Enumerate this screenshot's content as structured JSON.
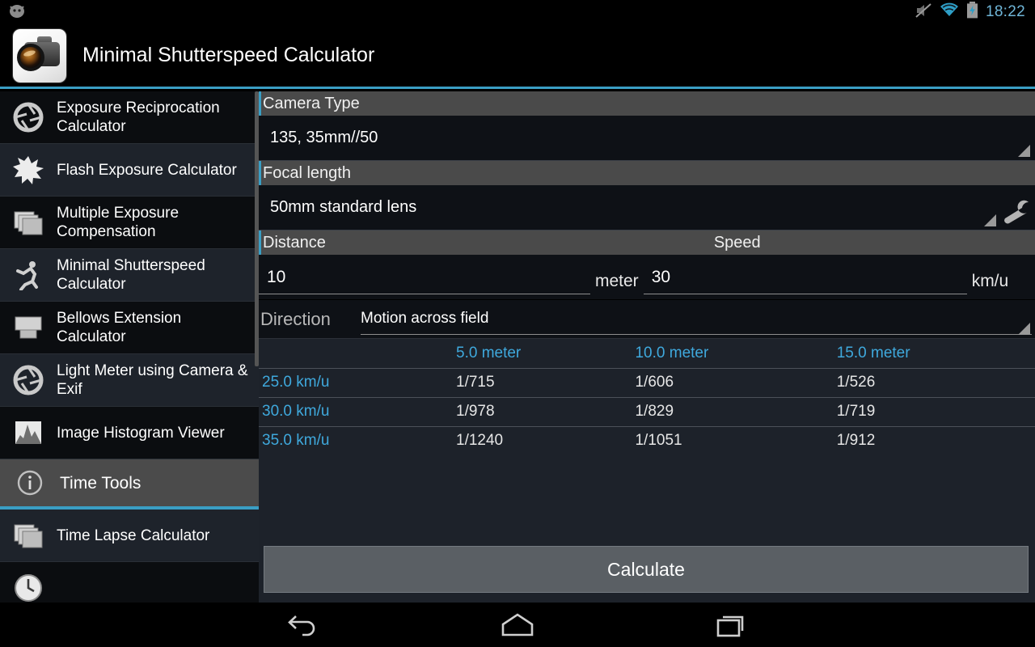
{
  "status_bar": {
    "notification_icon": "android-robot-icon",
    "icons": [
      "mute-icon",
      "wifi-icon",
      "battery-charging-icon"
    ],
    "time": "18:22",
    "time_color": "#6fb6d8"
  },
  "action_bar": {
    "app_icon": "camera-app-icon",
    "title": "Minimal Shutterspeed Calculator",
    "accent_color": "#3a9ec4"
  },
  "sidebar": {
    "items": [
      {
        "label": "Exposure Reciprocation Calculator",
        "icon": "aperture-icon"
      },
      {
        "label": "Flash Exposure Calculator",
        "icon": "flash-burst-icon"
      },
      {
        "label": "Multiple Exposure Compensation",
        "icon": "stacked-layers-icon"
      },
      {
        "label": "Minimal Shutterspeed Calculator",
        "icon": "running-person-icon"
      },
      {
        "label": "Bellows Extension Calculator",
        "icon": "bellows-icon"
      },
      {
        "label": "Light Meter using Camera & Exif",
        "icon": "aperture-icon"
      },
      {
        "label": "Image Histogram Viewer",
        "icon": "histogram-icon"
      }
    ],
    "section": {
      "label": "Time Tools",
      "icon": "info-circle-icon"
    },
    "section_items": [
      {
        "label": "Time Lapse Calculator",
        "icon": "stacked-layers-icon"
      },
      {
        "label": "",
        "icon": "clock-icon"
      }
    ]
  },
  "main": {
    "camera_type": {
      "header": "Camera Type",
      "value": "135, 35mm//50"
    },
    "focal_length": {
      "header": "Focal length",
      "value": "50mm standard lens",
      "tool_icon": "wrench-icon"
    },
    "distance": {
      "header": "Distance",
      "value": "10",
      "unit": "meter"
    },
    "speed": {
      "header": "Speed",
      "value": "30",
      "unit": "km/u"
    },
    "direction": {
      "label": "Direction",
      "value": "Motion across field"
    },
    "calculate_label": "Calculate"
  },
  "results_table": {
    "corner": "",
    "columns": [
      "5.0 meter",
      "10.0 meter",
      "15.0 meter"
    ],
    "rows": [
      {
        "header": "25.0 km/u",
        "cells": [
          "1/715",
          "1/606",
          "1/526"
        ]
      },
      {
        "header": "30.0 km/u",
        "cells": [
          "1/978",
          "1/829",
          "1/719"
        ]
      },
      {
        "header": "35.0 km/u",
        "cells": [
          "1/1240",
          "1/1051",
          "1/912"
        ]
      }
    ],
    "header_color": "#3fa9dd"
  },
  "nav_bar": {
    "buttons": [
      "back-icon",
      "home-icon",
      "recents-icon"
    ]
  }
}
